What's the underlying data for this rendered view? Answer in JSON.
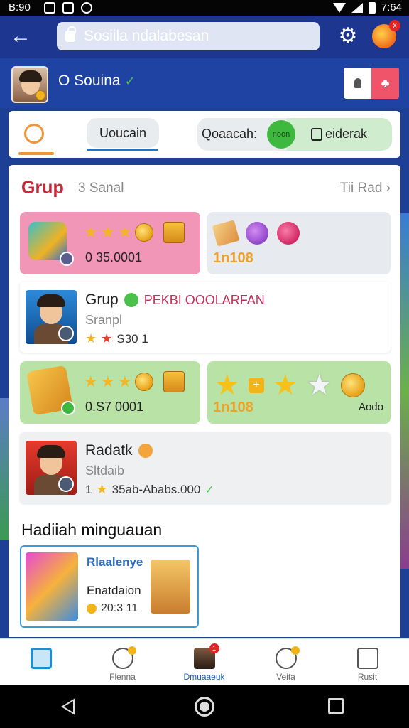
{
  "status_bar": {
    "time_left": "B:90",
    "time_right": "7:64"
  },
  "app_bar": {
    "search_text": "Sosiila ndalabesan",
    "notification_badge": "x"
  },
  "profile": {
    "name": "O Souina"
  },
  "tabs": {
    "pill_label": "Uoucain",
    "toggle_left_label": "Qoaacah:",
    "toggle_knob_text": "noon",
    "toggle_right_label": "eiderak"
  },
  "section": {
    "title": "Grup",
    "subtitle": "3 Sanal",
    "link": "Tii Rad"
  },
  "cards": {
    "pink_value": "0 35.0001",
    "gray_count": "1n108",
    "green_value": "0.S7 0001",
    "green2_count": "1n108",
    "green2_label": "Aodo"
  },
  "list": [
    {
      "title": "Grup",
      "tag": "PEKBI OOOLARFAN",
      "sub": "Sranpl",
      "meta": "S30 1"
    },
    {
      "title": "Radatk",
      "tag": "",
      "sub": "Sltdaib",
      "meta_prefix": "1",
      "meta": "35ab-Ababs.000"
    }
  ],
  "bonus": {
    "section_title": "Hadiiah minguauan",
    "head": "Rlaalenye",
    "sub": "Enatdaion",
    "meta": "20:3 11"
  },
  "bottom_nav": [
    {
      "label": ""
    },
    {
      "label": "Flenna"
    },
    {
      "label": "Dmuaaeuk",
      "badge": "1"
    },
    {
      "label": "Veita"
    },
    {
      "label": "Rusit"
    }
  ],
  "colors": {
    "accent_red": "#c62838",
    "accent_blue": "#1d3790",
    "accent_green": "#3fb83f"
  }
}
